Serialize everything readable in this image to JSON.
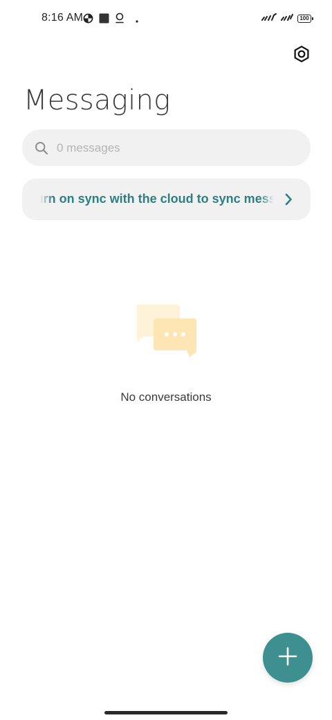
{
  "status_bar": {
    "time": "8:16 AM",
    "battery": "100",
    "left_icons": [
      "data-saver-icon",
      "square-notification-icon",
      "location-icon",
      "dot-icon"
    ],
    "right_icons": [
      "signal-icon",
      "signal-icon",
      "battery-icon"
    ]
  },
  "header": {
    "title": "Messaging",
    "settings_icon": "settings-hexagon-icon"
  },
  "search": {
    "placeholder": "0 messages",
    "value": ""
  },
  "sync_banner": {
    "text": "Turn on sync with the cloud to sync messages",
    "chevron_icon": "chevron-right-icon"
  },
  "empty_state": {
    "illustration": "chat-bubbles-icon",
    "label": "No conversations"
  },
  "fab": {
    "icon": "plus-icon"
  },
  "colors": {
    "accent": "#3d8f90",
    "sync_text": "#2e7f82",
    "surface": "#f1f1f1",
    "illustration": "#fde6b3"
  }
}
